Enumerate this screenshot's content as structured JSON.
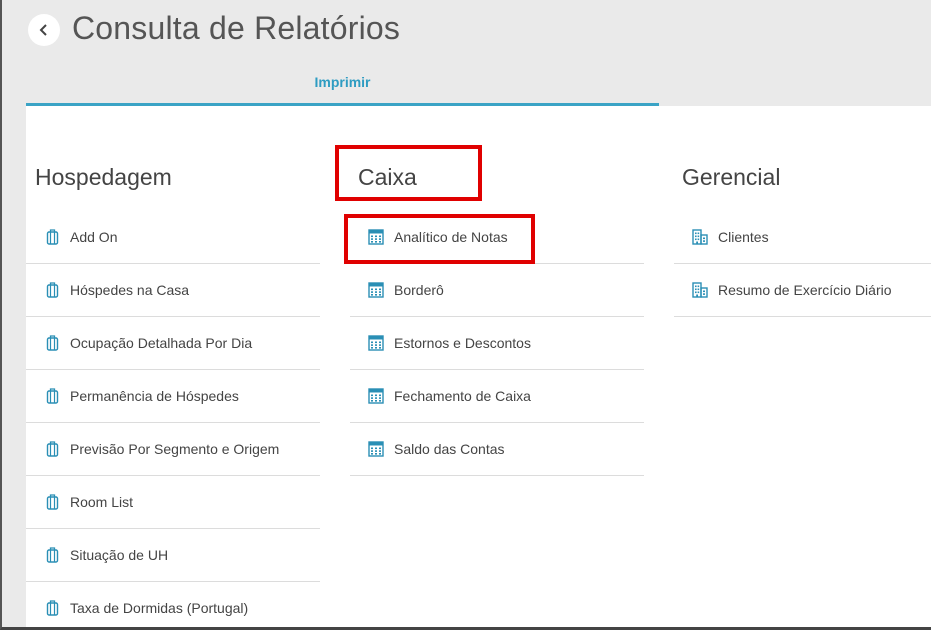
{
  "header": {
    "title": "Consulta de Relatórios",
    "back_icon": "chevron-left-icon"
  },
  "tabs": [
    {
      "label": "Imprimir",
      "active": true
    }
  ],
  "columns": {
    "hospedagem": {
      "title": "Hospedagem",
      "icon": "luggage-icon",
      "items": [
        "Add On",
        "Hóspedes na Casa",
        "Ocupação Detalhada Por Dia",
        "Permanência de Hóspedes",
        "Previsão Por Segmento e Origem",
        "Room List",
        "Situação de UH",
        "Taxa de Dormidas (Portugal)"
      ]
    },
    "caixa": {
      "title": "Caixa",
      "icon": "calculator-icon",
      "items": [
        "Analítico de Notas",
        "Borderô",
        "Estornos e Descontos",
        "Fechamento de Caixa",
        "Saldo das Contas"
      ]
    },
    "gerencial": {
      "title": "Gerencial",
      "icon": "building-icon",
      "items": [
        "Clientes",
        "Resumo de Exercício Diário"
      ]
    }
  },
  "colors": {
    "accent": "#2e9cc2",
    "highlight": "#e00000",
    "icon": "#2a8fb5"
  }
}
